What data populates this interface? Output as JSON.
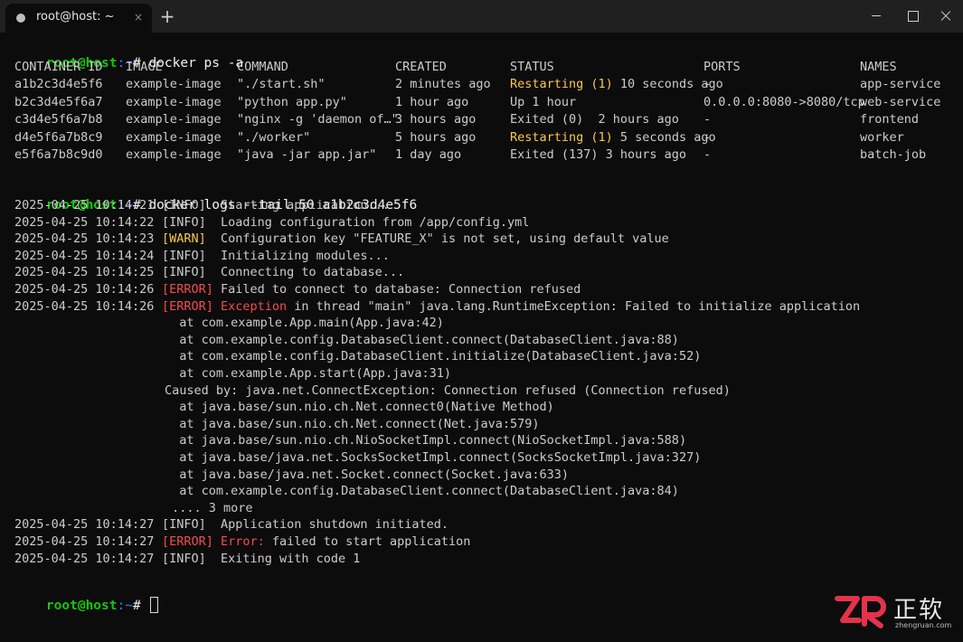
{
  "tab": {
    "title": "root@host: ~",
    "close_glyph": "×",
    "new_glyph": "+"
  },
  "prompt": {
    "user_host": "root@host",
    "path": ":~",
    "symbol": "# "
  },
  "commands": {
    "ps": "docker ps -a",
    "logs": "docker logs --tail 50 a1b2c3d4e5f6"
  },
  "ps_table": {
    "headers": [
      "CONTAINER ID",
      "IMAGE",
      "COMMAND",
      "CREATED",
      "STATUS",
      "PORTS",
      "NAMES"
    ],
    "rows": [
      {
        "id": "a1b2c3d4e5f6",
        "image": "example-image",
        "command": "\"./start.sh\"",
        "created": "2 minutes ago",
        "status_hl": "Restarting (1)",
        "status_rest": " 10 seconds ago",
        "ports": "-",
        "name": "app-service"
      },
      {
        "id": "b2c3d4e5f6a7",
        "image": "example-image",
        "command": "\"python app.py\"",
        "created": "1 hour ago",
        "status_hl": "",
        "status_rest": "Up 1 hour",
        "ports": "0.0.0.0:8080->8080/tcp",
        "name": "web-service"
      },
      {
        "id": "c3d4e5f6a7b8",
        "image": "example-image",
        "command": "\"nginx -g 'daemon of…\"",
        "created": "3 hours ago",
        "status_hl": "",
        "status_rest": "Exited (0)  2 hours ago",
        "ports": "-",
        "name": "frontend"
      },
      {
        "id": "d4e5f6a7b8c9",
        "image": "example-image",
        "command": "\"./worker\"",
        "created": "5 hours ago",
        "status_hl": "Restarting (1)",
        "status_rest": " 5 seconds ago",
        "ports": "-",
        "name": "worker"
      },
      {
        "id": "e5f6a7b8c9d0",
        "image": "example-image",
        "command": "\"java -jar app.jar\"",
        "created": "1 day ago",
        "status_hl": "",
        "status_rest": "Exited (137) 3 hours ago",
        "ports": "-",
        "name": "batch-job"
      }
    ]
  },
  "logs": [
    {
      "ts": "2025-04-25 10:14:21",
      "level": "[INFO]",
      "msg": "Starting application..."
    },
    {
      "ts": "2025-04-25 10:14:22",
      "level": "[INFO]",
      "msg": "Loading configuration from /app/config.yml"
    },
    {
      "ts": "2025-04-25 10:14:23",
      "level": "[WARN]",
      "msg": "Configuration key \"FEATURE_X\" is not set, using default value"
    },
    {
      "ts": "2025-04-25 10:14:24",
      "level": "[INFO]",
      "msg": "Initializing modules..."
    },
    {
      "ts": "2025-04-25 10:14:25",
      "level": "[INFO]",
      "msg": "Connecting to database..."
    },
    {
      "ts": "2025-04-25 10:14:26",
      "level": "[ERROR]",
      "msg": "Failed to connect to database: Connection refused"
    },
    {
      "ts": "2025-04-25 10:14:26",
      "level": "[ERROR]",
      "msg_hl": "Exception",
      "msg": " in thread \"main\" java.lang.RuntimeException: Failed to initialize application"
    }
  ],
  "stack": [
    "  at com.example.App.main(App.java:42)",
    "  at com.example.config.DatabaseClient.connect(DatabaseClient.java:88)",
    "  at com.example.config.DatabaseClient.initialize(DatabaseClient.java:52)",
    "  at com.example.App.start(App.java:31)",
    "Caused by: java.net.ConnectException: Connection refused (Connection refused)",
    "  at java.base/sun.nio.ch.Net.connect0(Native Method)",
    "  at java.base/sun.nio.ch.Net.connect(Net.java:579)",
    "  at java.base/sun.nio.ch.NioSocketImpl.connect(NioSocketImpl.java:588)",
    "  at java.base/java.net.SocksSocketImpl.connect(SocksSocketImpl.java:327)",
    "  at java.base/java.net.Socket.connect(Socket.java:633)",
    "  at com.example.config.DatabaseClient.connect(DatabaseClient.java:84)",
    " .... 3 more"
  ],
  "logs_tail": [
    {
      "ts": "2025-04-25 10:14:27",
      "level": "[INFO]",
      "msg_hl": "",
      "msg": "Application shutdown initiated."
    },
    {
      "ts": "2025-04-25 10:14:27",
      "level": "[ERROR]",
      "msg_hl": "Error:",
      "msg": " failed to start application"
    },
    {
      "ts": "2025-04-25 10:14:27",
      "level": "[INFO]",
      "msg_hl": "",
      "msg": "Exiting with code 1"
    }
  ],
  "watermark": {
    "brand": "正软",
    "domain": "zhengruan.com"
  },
  "colors": {
    "prompt_user": "#16c60c",
    "prompt_path": "#3b78ff",
    "warn": "#f9c74f",
    "error": "#f14c4c",
    "background": "#0c0c0c"
  }
}
